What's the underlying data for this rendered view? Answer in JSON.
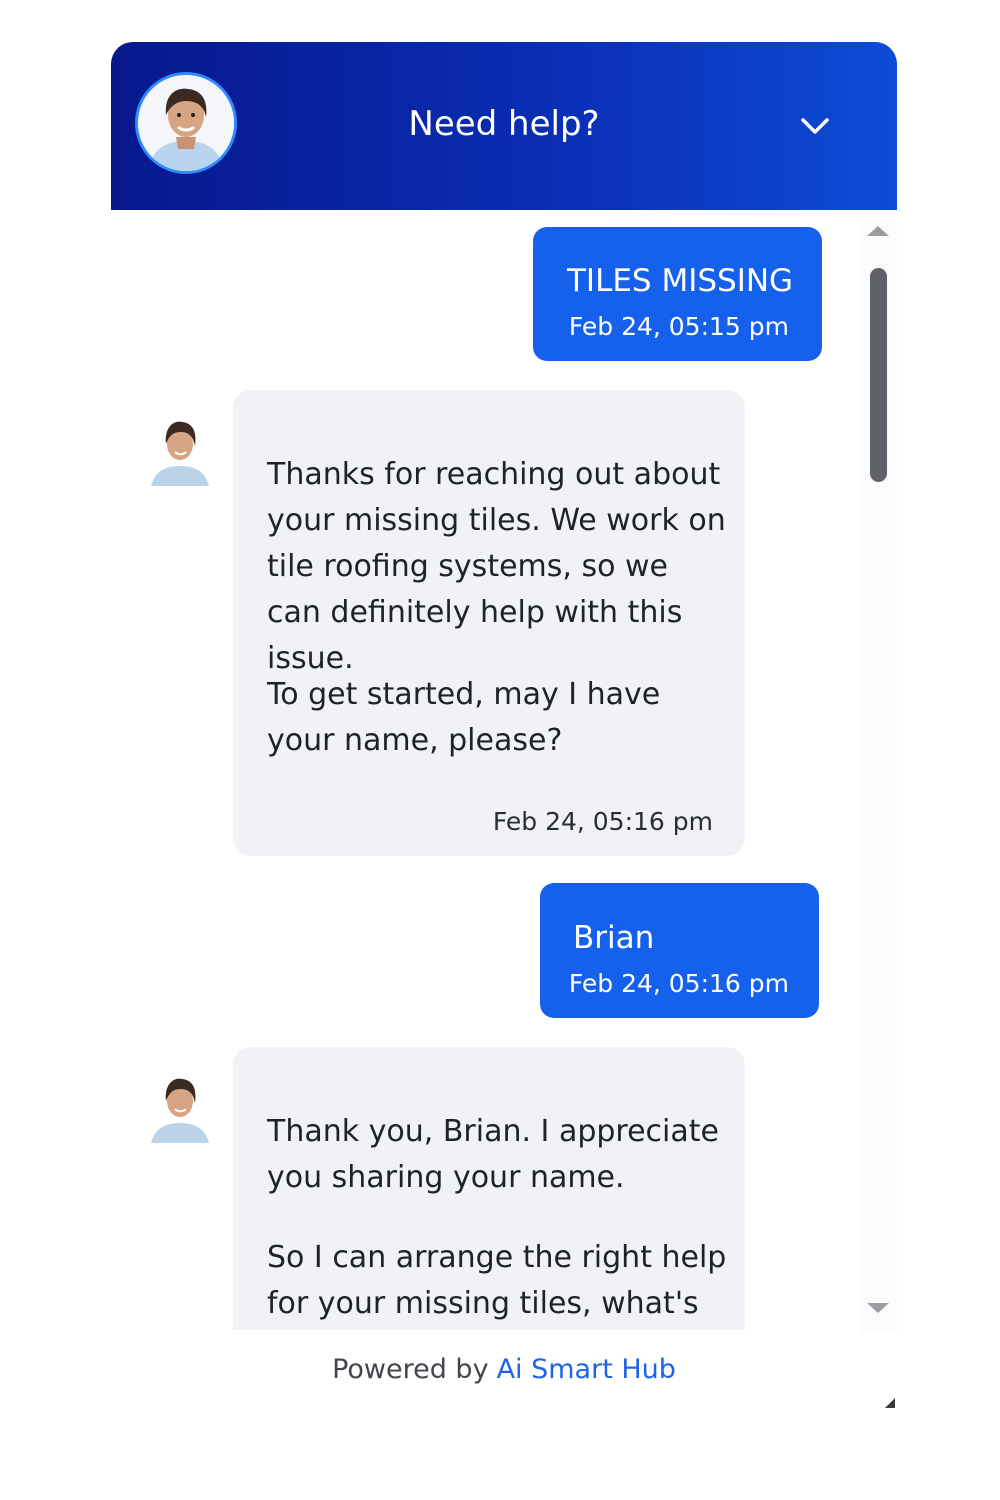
{
  "header": {
    "title": "Need help?",
    "accent_color": "#0a2db4",
    "avatar_icon": "agent-avatar",
    "collapse_icon": "chevron-down-icon"
  },
  "messages": [
    {
      "sender": "user",
      "text": "TILES MISSING",
      "time": "Feb 24, 05:15 pm"
    },
    {
      "sender": "bot",
      "paragraphs": [
        "Thanks for reaching out about your missing tiles. We work on tile roofing systems, so we can definitely help with this issue.",
        "To get started, may I have your name, please?"
      ],
      "time": "Feb 24, 05:16 pm"
    },
    {
      "sender": "user",
      "text": "Brian",
      "time": "Feb 24, 05:16 pm"
    },
    {
      "sender": "bot",
      "paragraphs": [
        "Thank you, Brian. I appreciate you sharing your name.",
        "So I can arrange the right help for your missing tiles, what's"
      ]
    }
  ],
  "colors": {
    "user_bubble": "#1561ec",
    "bot_bubble": "#f0f2f6",
    "link": "#1f64e6"
  },
  "footer": {
    "powered_by": "Powered by",
    "brand": "Ai Smart Hub"
  }
}
